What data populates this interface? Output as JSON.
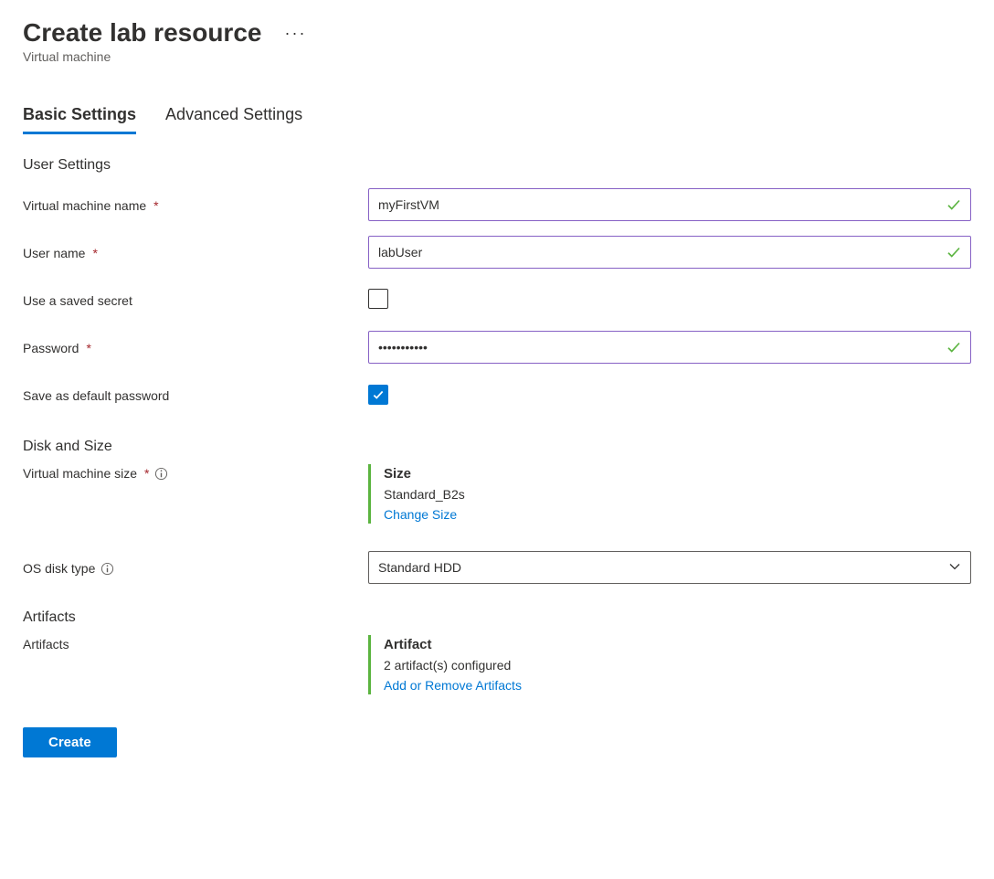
{
  "header": {
    "title": "Create lab resource",
    "subtitle": "Virtual machine"
  },
  "tabs": {
    "basic": "Basic Settings",
    "advanced": "Advanced Settings"
  },
  "sections": {
    "user_settings": "User Settings",
    "disk_size": "Disk and Size",
    "artifacts": "Artifacts"
  },
  "labels": {
    "vm_name": "Virtual machine name",
    "user_name": "User name",
    "saved_secret": "Use a saved secret",
    "password": "Password",
    "save_default": "Save as default password",
    "vm_size": "Virtual machine size",
    "os_disk": "OS disk type",
    "artifacts": "Artifacts"
  },
  "values": {
    "vm_name": "myFirstVM",
    "user_name": "labUser",
    "password": "•••••••••••",
    "os_disk": "Standard HDD"
  },
  "size_block": {
    "title": "Size",
    "value": "Standard_B2s",
    "link": "Change Size"
  },
  "artifact_block": {
    "title": "Artifact",
    "value": "2 artifact(s) configured",
    "link": "Add or Remove Artifacts"
  },
  "buttons": {
    "create": "Create"
  },
  "colors": {
    "primary": "#0078d4",
    "valid_green": "#5bb440",
    "input_border": "#8661c5",
    "danger": "#a4262c"
  },
  "checkboxes": {
    "saved_secret": false,
    "save_default": true
  }
}
